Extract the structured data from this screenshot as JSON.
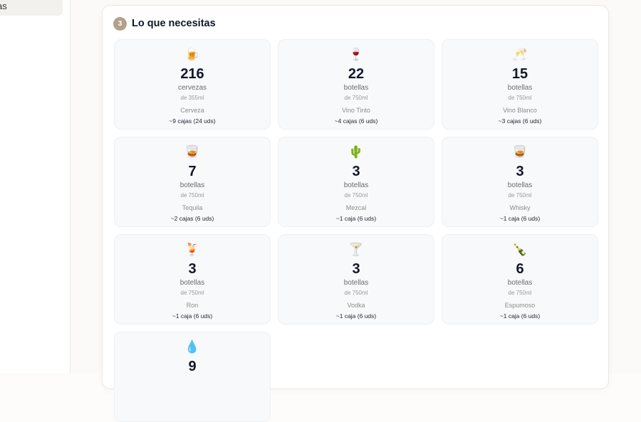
{
  "sidebar": {
    "partial_item": "as"
  },
  "section": {
    "step": "3",
    "title": "Lo que necesitas"
  },
  "items": [
    {
      "icon": "🍺",
      "icon_name": "beer-mug-icon",
      "qty": "216",
      "unit": "cervezas",
      "size": "de 355ml",
      "name": "Cerveza",
      "boxes": "~9 cajas (24 uds)"
    },
    {
      "icon": "🍷",
      "icon_name": "wine-glass-icon",
      "qty": "22",
      "unit": "botellas",
      "size": "de 750ml",
      "name": "Vino Tinto",
      "boxes": "~4 cajas (6 uds)"
    },
    {
      "icon": "🥂",
      "icon_name": "clinking-glasses-icon",
      "qty": "15",
      "unit": "botellas",
      "size": "de 750ml",
      "name": "Vino Blanco",
      "boxes": "~3 cajas (6 uds)"
    },
    {
      "icon": "🥃",
      "icon_name": "tumbler-glass-icon",
      "qty": "7",
      "unit": "botellas",
      "size": "de 750ml",
      "name": "Tequila",
      "boxes": "~2 cajas (6 uds)"
    },
    {
      "icon": "🌵",
      "icon_name": "cactus-icon",
      "qty": "3",
      "unit": "botellas",
      "size": "de 750ml",
      "name": "Mezcal",
      "boxes": "~1 caja (6 uds)"
    },
    {
      "icon": "🥃",
      "icon_name": "tumbler-glass-icon",
      "qty": "3",
      "unit": "botellas",
      "size": "de 750ml",
      "name": "Whisky",
      "boxes": "~1 caja (6 uds)"
    },
    {
      "icon": "🍹",
      "icon_name": "tropical-drink-icon",
      "qty": "3",
      "unit": "botellas",
      "size": "de 750ml",
      "name": "Ron",
      "boxes": "~1 caja (6 uds)"
    },
    {
      "icon": "🍸",
      "icon_name": "cocktail-glass-icon",
      "qty": "3",
      "unit": "botellas",
      "size": "de 750ml",
      "name": "Vodka",
      "boxes": "~1 caja (6 uds)"
    },
    {
      "icon": "🍾",
      "icon_name": "champagne-bottle-icon",
      "qty": "6",
      "unit": "botellas",
      "size": "de 750ml",
      "name": "Espumoso",
      "boxes": "~1 caja (6 uds)"
    },
    {
      "icon": "💧",
      "icon_name": "droplet-icon",
      "qty": "9",
      "unit": "",
      "size": "",
      "name": "",
      "boxes": ""
    }
  ],
  "colors": {
    "accent_badge": "#b3a08a",
    "card_bg": "#f8f9fb",
    "text_dark": "#111827"
  }
}
